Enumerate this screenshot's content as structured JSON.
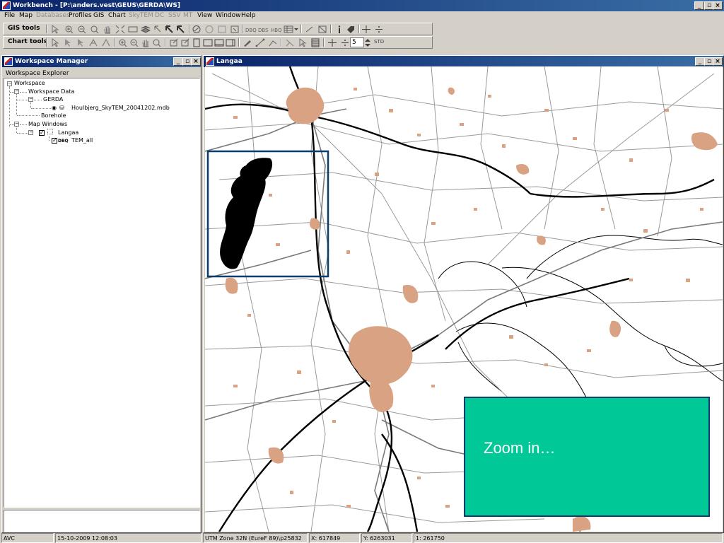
{
  "app": {
    "title": "Workbench - [P:\\anders.vest\\GEUS\\GERDA\\WS]"
  },
  "menu": {
    "items": [
      {
        "label": "File",
        "enabled": true
      },
      {
        "label": "Map",
        "enabled": true
      },
      {
        "label": "Databases",
        "enabled": false
      },
      {
        "label": "Profiles",
        "enabled": true
      },
      {
        "label": "GIS",
        "enabled": true
      },
      {
        "label": "Chart",
        "enabled": true
      },
      {
        "label": "SkyTEM",
        "enabled": false
      },
      {
        "label": "DC",
        "enabled": false
      },
      {
        "label": "SSV",
        "enabled": false
      },
      {
        "label": "MT",
        "enabled": false
      },
      {
        "label": "View",
        "enabled": true
      },
      {
        "label": "Window",
        "enabled": true
      },
      {
        "label": "Help",
        "enabled": true
      }
    ]
  },
  "toolbars": {
    "gis_label": "GIS tools",
    "chart_label": "Chart tools",
    "spin_value": "5",
    "std_label": "STD"
  },
  "workspace_manager": {
    "title": "Workspace Manager",
    "explorer_label": "Workspace Explorer",
    "tree": {
      "root": "Workspace",
      "data": "Workspace Data",
      "gerda": "GERDA",
      "mdb_file": "Houlbjerg_SkyTEM_20041202.mdb",
      "borehole": "Borehole",
      "map_windows": "Map Windows",
      "langaa": "Langaa",
      "layer_tag": "DBQ",
      "layer": "TEM_all"
    }
  },
  "map_window": {
    "title": "Langaa",
    "callout_text": "Zoom in…"
  },
  "status": {
    "user": "AVC",
    "datetime": "15-10-2009 12:08:03",
    "projection": "UTM Zone 32N (EureF 89)\\p25832",
    "x": "X: 617849",
    "y": "Y: 6263031",
    "scale": "1: 261750"
  },
  "colors": {
    "titlebar": "#0a246a",
    "town_fill": "#d9a383",
    "callout_fill": "#00c896",
    "callout_border": "#0b3c6e",
    "selection_box": "#0b3c6e"
  }
}
